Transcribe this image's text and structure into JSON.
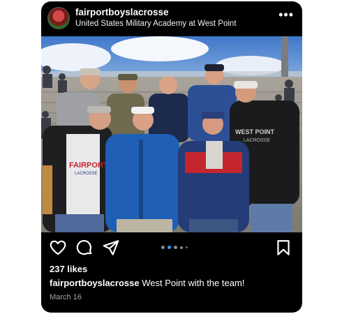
{
  "post": {
    "username": "fairportboyslacrosse",
    "location": "United States Military Academy at West Point",
    "more_icon": "more-horizontal-icon",
    "photo_alt": "Group of seven men posing in the stands at a stadium",
    "photo_text": {
      "shirt_left": "FAIRPORT",
      "shirt_left_sub": "LACROSSE",
      "shirt_right": "WEST POINT",
      "shirt_right_sub": "LACROSSE"
    },
    "actions": {
      "like_icon": "heart-icon",
      "comment_icon": "comment-icon",
      "share_icon": "send-icon",
      "save_icon": "bookmark-icon"
    },
    "carousel": {
      "count": 5,
      "active_index": 1
    },
    "likes": "237 likes",
    "caption_user": "fairportboyslacrosse",
    "caption_text": "West Point with the team!",
    "date": "March 16"
  },
  "colors": {
    "background": "#000000",
    "text": "#ffffff",
    "muted": "#a8a8a8",
    "active_dot": "#3897f0"
  }
}
